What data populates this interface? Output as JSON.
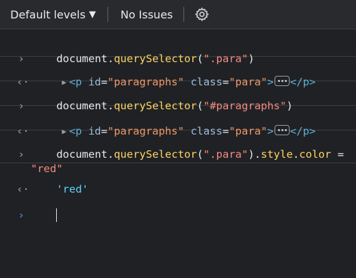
{
  "toolbar": {
    "levels_label": "Default levels",
    "levels_caret": "▼",
    "issues_label": "No Issues"
  },
  "console": {
    "gutter_input": "›",
    "gutter_output": "‹·",
    "entries": [
      {
        "type": "input",
        "obj": "document",
        "dot": ".",
        "method": "querySelector",
        "open": "(",
        "arg": "\".para\"",
        "close": ")"
      },
      {
        "type": "output",
        "open_tag": "<p",
        "attr1": "id",
        "eq1": "=",
        "val1": "\"paragraphs\"",
        "attr2": "class",
        "eq2": "=",
        "val2": "\"para\"",
        "gt": ">",
        "close_tag": "</p>"
      },
      {
        "type": "input",
        "obj": "document",
        "dot": ".",
        "method": "querySelector",
        "open": "(",
        "arg": "\"#paragraphs\"",
        "close": ")"
      },
      {
        "type": "output",
        "open_tag": "<p",
        "attr1": "id",
        "eq1": "=",
        "val1": "\"paragraphs\"",
        "attr2": "class",
        "eq2": "=",
        "val2": "\"para\"",
        "gt": ">",
        "close_tag": "</p>"
      },
      {
        "type": "input",
        "obj": "document",
        "dot": ".",
        "method": "querySelector",
        "open": "(",
        "arg": "\".para\"",
        "close": ")",
        "dot2": ".",
        "prop1": "style",
        "dot3": ".",
        "prop2": "color",
        "assign": " =",
        "value": "\"red\""
      },
      {
        "type": "output",
        "result": "'red'"
      }
    ]
  },
  "colors": {
    "background": "#202124",
    "toolbar": "#292a2d",
    "method": "#fdd663",
    "string": "#f28b82",
    "tag": "#5db0d7",
    "attr_value": "#f29766",
    "result_string": "#5cd5fb",
    "prompt": "#4d90fe"
  }
}
